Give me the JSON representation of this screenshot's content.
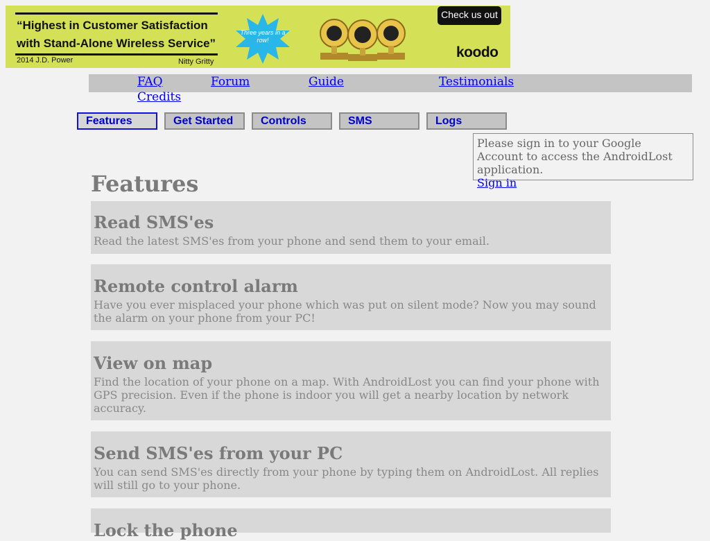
{
  "banner": {
    "headline_line1": "“Highest in Customer Satisfaction",
    "headline_line2": "with Stand-Alone Wireless Service”",
    "source": "2014 J.D. Power",
    "tagline": "Nitty Gritty",
    "badge": "Three years in a row!",
    "cta": "Check us out",
    "brand": "koodo",
    "colors": {
      "background": "#d4e157",
      "badge": "#29b6e8",
      "dark": "#111111"
    }
  },
  "top_links": [
    "FAQ",
    "Forum",
    "Guide",
    "Testimonials",
    "Credits"
  ],
  "tabs": [
    {
      "label": "Features",
      "active": true
    },
    {
      "label": "Get Started",
      "active": false
    },
    {
      "label": "Controls",
      "active": false
    },
    {
      "label": "SMS",
      "active": false
    },
    {
      "label": "Logs",
      "active": false
    }
  ],
  "signin": {
    "message": "Please sign in to your Google Account to access the AndroidLost application.",
    "link": "Sign in"
  },
  "page": {
    "title": "Features"
  },
  "features": [
    {
      "title": "Read SMS'es",
      "text": "Read the latest SMS'es from your phone and send them to your email."
    },
    {
      "title": "Remote control alarm",
      "text": "Have you ever misplaced your phone which was put on silent mode? Now you may sound the alarm on your phone from your PC!"
    },
    {
      "title": "View on map",
      "text": "Find the location of your phone on a map. With AndroidLost you can find your phone with GPS precision. Even if the phone is indoor you will get a nearby location by network accuracy."
    },
    {
      "title": "Send SMS'es from your PC",
      "text": "You can send SMS'es directly from your phone by typing them on AndroidLost. All replies will still go to your phone."
    },
    {
      "title": "Lock the phone",
      "text": ""
    }
  ],
  "colors": {
    "link": "#0000ee",
    "tab_text": "#0000cc",
    "active_tab_border": "#1010dd",
    "muted_text": "#7a7a7a"
  }
}
